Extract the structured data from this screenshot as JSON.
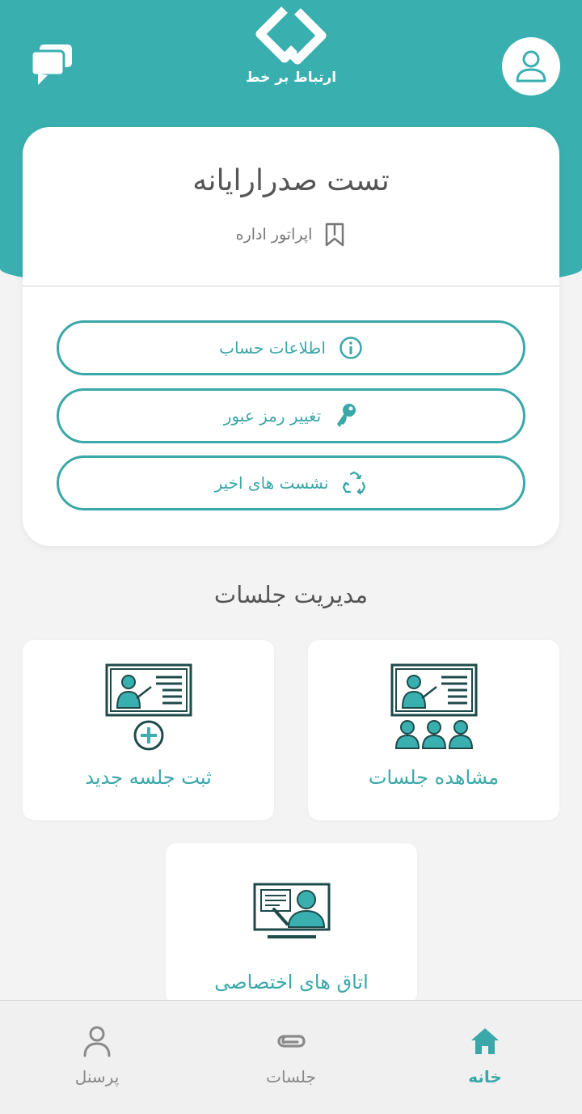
{
  "header": {
    "app_name": "ارتباط بر خط",
    "chat_icon": "chat-bubbles-icon",
    "profile_icon": "user-icon"
  },
  "profile": {
    "name": "تست صدرارایانه",
    "role": "اپراتور اداره",
    "role_icon": "bookmark-icon",
    "actions": [
      {
        "label": "اطلاعات حساب",
        "icon": "info-icon"
      },
      {
        "label": "تغییر رمز عبور",
        "icon": "key-icon"
      },
      {
        "label": "نشست های اخیر",
        "icon": "recycle-icon"
      }
    ]
  },
  "sessions": {
    "title": "مدیریت جلسات",
    "tiles": [
      {
        "label": "مشاهده جلسات",
        "icon": "presentation-audience-icon"
      },
      {
        "label": "ثبت جلسه جدید",
        "icon": "presentation-add-icon"
      },
      {
        "label": "اتاق های اختصاصی",
        "icon": "video-room-icon"
      }
    ]
  },
  "nav": {
    "items": [
      {
        "label": "خانه",
        "icon": "home-icon",
        "active": true
      },
      {
        "label": "جلسات",
        "icon": "paperclip-icon",
        "active": false
      },
      {
        "label": "پرسنل",
        "icon": "person-icon",
        "active": false
      }
    ]
  },
  "colors": {
    "primary": "#3aafb0",
    "accent_text": "#3aa7a8",
    "dark_icon": "#1e4a4a",
    "background": "#f3f3f3"
  }
}
